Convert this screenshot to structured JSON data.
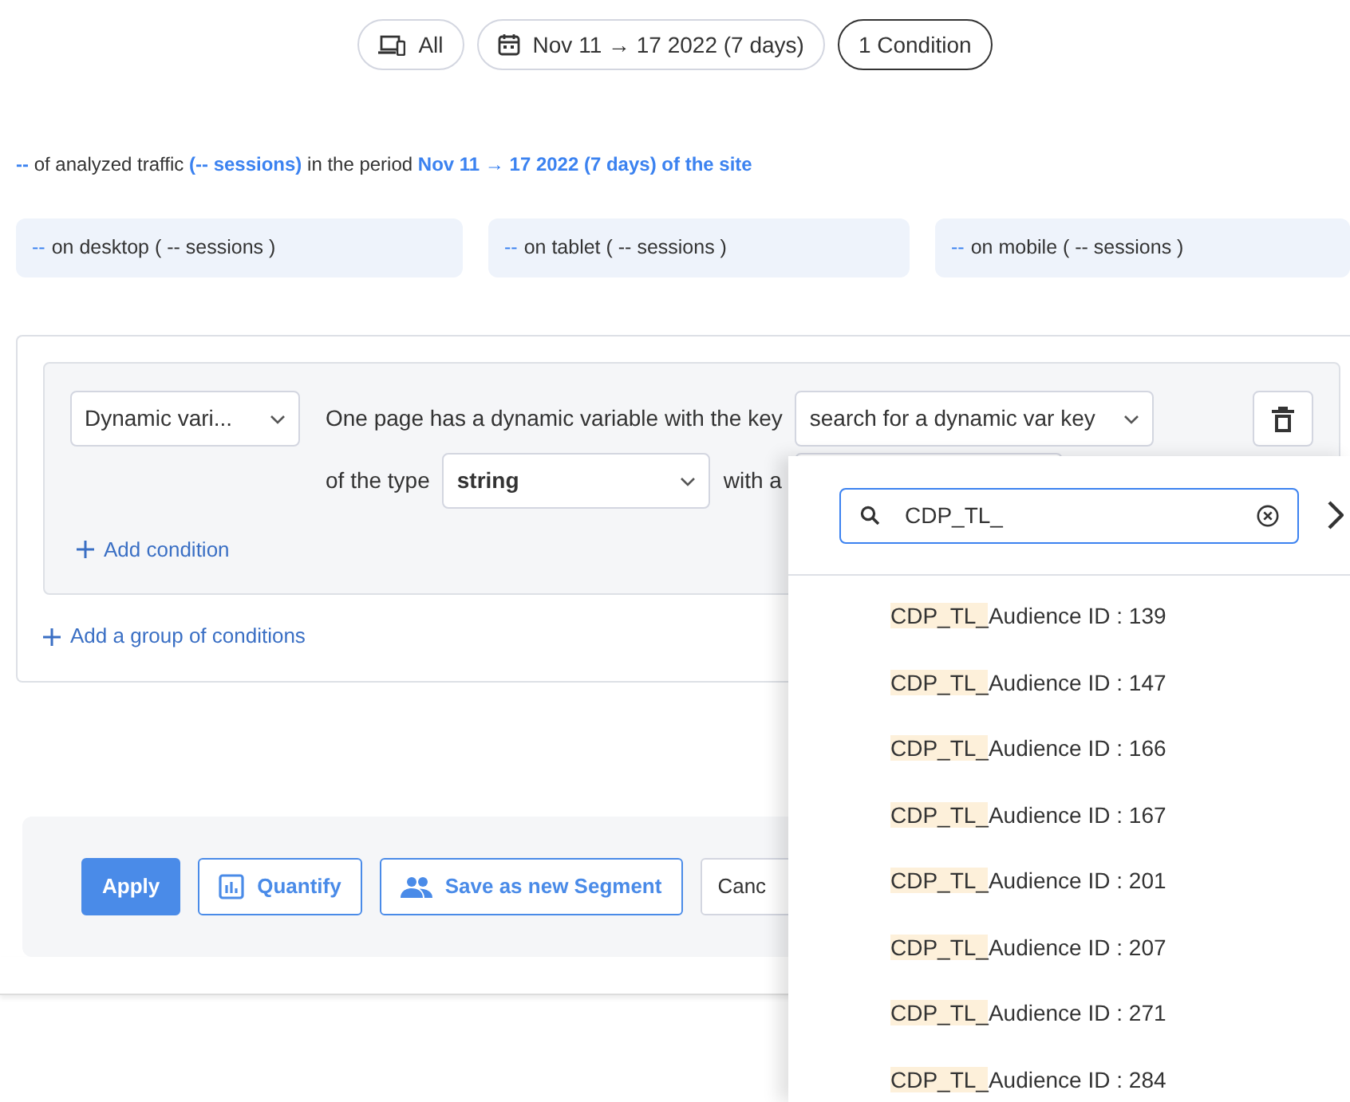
{
  "filters": [
    {
      "kind": "device",
      "label": "All",
      "selected": false
    },
    {
      "kind": "date",
      "label": "Nov 11 → 17 2022 (7 days)",
      "selected": false
    },
    {
      "kind": "plain",
      "label": "1 Condition",
      "selected": true
    }
  ],
  "summary": "**--** of analyzed traffic **(-- sessions)** in the period **Nov 11 → 17 2022 (7 days) of the site**",
  "devices": [
    {
      "value": "--",
      "label": "on desktop ( -- sessions )"
    },
    {
      "value": "--",
      "label": "on tablet ( -- sessions )"
    },
    {
      "value": "--",
      "label": "on mobile ( -- sessions )"
    }
  ],
  "condition": {
    "type_select": "Dynamic vari...",
    "key_text": "One page has a dynamic variable with the key",
    "key_select": "search for a dynamic var key",
    "type_text": "of the type",
    "value_type": "string",
    "with_text": "with a",
    "add_condition": "Add condition"
  },
  "add_group": "Add a group of conditions",
  "actions": [
    {
      "kind": "primary",
      "label": "Apply"
    },
    {
      "kind": "quantify",
      "label": "Quantify"
    },
    {
      "kind": "segment",
      "label": "Save as new Segment"
    },
    {
      "kind": "plain",
      "label": "Canc"
    }
  ],
  "dropdown": {
    "search_value": "CDP_TL_",
    "options": [
      {
        "match": "CDP_TL_",
        "rest": "Audience ID : 139"
      },
      {
        "match": "CDP_TL_",
        "rest": "Audience ID : 147"
      },
      {
        "match": "CDP_TL_",
        "rest": "Audience ID : 166"
      },
      {
        "match": "CDP_TL_",
        "rest": "Audience ID : 167"
      },
      {
        "match": "CDP_TL_",
        "rest": "Audience ID : 201"
      },
      {
        "match": "CDP_TL_",
        "rest": "Audience ID : 207"
      },
      {
        "match": "CDP_TL_",
        "rest": "Audience ID : 271"
      },
      {
        "match": "CDP_TL_",
        "rest": "Audience ID : 284"
      }
    ]
  }
}
